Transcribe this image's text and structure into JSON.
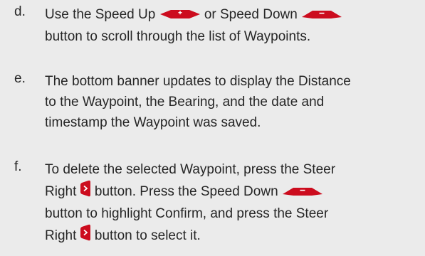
{
  "steps": [
    {
      "marker": "d.",
      "lines": [
        [
          "Use the Speed Up ",
          {
            "icon": "speed-up-icon"
          },
          " or Speed Down ",
          {
            "icon": "speed-down-icon"
          }
        ],
        [
          "button to scroll through the list of Waypoints."
        ]
      ]
    },
    {
      "marker": "e.",
      "lines": [
        [
          "The bottom banner updates to display the Distance"
        ],
        [
          "to the Waypoint, the Bearing, and the date and"
        ],
        [
          "timestamp the Waypoint was saved."
        ]
      ]
    },
    {
      "marker": "f.",
      "lines": [
        [
          "To delete the selected Waypoint, press the Steer"
        ],
        [
          "Right ",
          {
            "icon": "steer-right-icon"
          },
          " button. Press the Speed Down ",
          {
            "icon": "speed-down-icon"
          }
        ],
        [
          "button to highlight Confirm, and press the Steer"
        ],
        [
          "Right ",
          {
            "icon": "steer-right-icon"
          },
          " button to select it."
        ]
      ]
    }
  ],
  "colors": {
    "background": "#ebebeb",
    "text": "#262626",
    "button_red": "#cc0c1e"
  }
}
